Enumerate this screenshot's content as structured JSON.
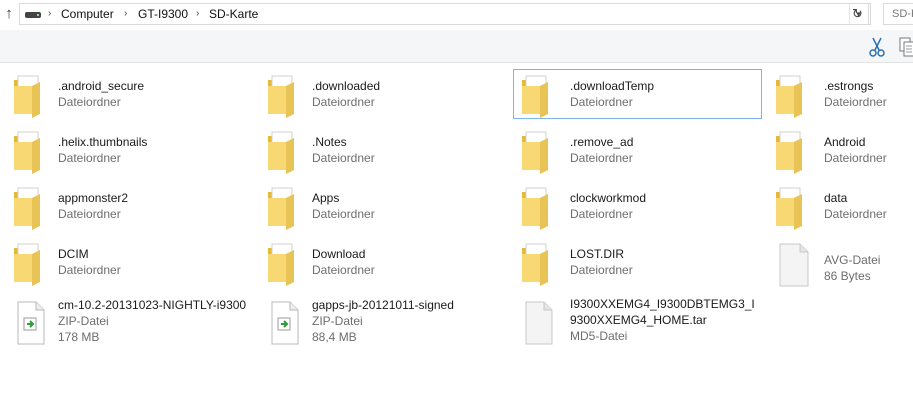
{
  "address": {
    "crumbs": [
      "Computer",
      "GT-I9300",
      "SD-Karte"
    ],
    "search_placeholder": "SD-K",
    "up_symbol": "↑",
    "dropdown_symbol": "▾",
    "refresh_symbol": "↻"
  },
  "items": [
    {
      "name": ".android_secure",
      "type": "Dateiordner"
    },
    {
      "name": ".downloaded",
      "type": "Dateiordner"
    },
    {
      "name": ".downloadTemp",
      "type": "Dateiordner",
      "selected": true
    },
    {
      "name": ".estrongs",
      "type": "Dateiordner"
    },
    {
      "name": ".helix.thumbnails",
      "type": "Dateiordner"
    },
    {
      "name": ".Notes",
      "type": "Dateiordner"
    },
    {
      "name": ".remove_ad",
      "type": "Dateiordner"
    },
    {
      "name": "Android",
      "type": "Dateiordner"
    },
    {
      "name": "appmonster2",
      "type": "Dateiordner"
    },
    {
      "name": "Apps",
      "type": "Dateiordner"
    },
    {
      "name": "clockworkmod",
      "type": "Dateiordner"
    },
    {
      "name": "data",
      "type": "Dateiordner"
    },
    {
      "name": "DCIM",
      "type": "Dateiordner"
    },
    {
      "name": "Download",
      "type": "Dateiordner"
    },
    {
      "name": "LOST.DIR",
      "type": "Dateiordner"
    },
    {
      "name": "AVG-Datei",
      "type": "86 Bytes"
    },
    {
      "name": "cm-10.2-20131023-NIGHTLY-i9300",
      "type": "ZIP-Datei",
      "size": "178 MB"
    },
    {
      "name": "gapps-jb-20121011-signed",
      "type": "ZIP-Datei",
      "size": "88,4 MB"
    },
    {
      "name": "I9300XXEMG4_I9300DBTEMG3_I9300XXEMG4_HOME.tar",
      "type": "MD5-Datei"
    }
  ]
}
